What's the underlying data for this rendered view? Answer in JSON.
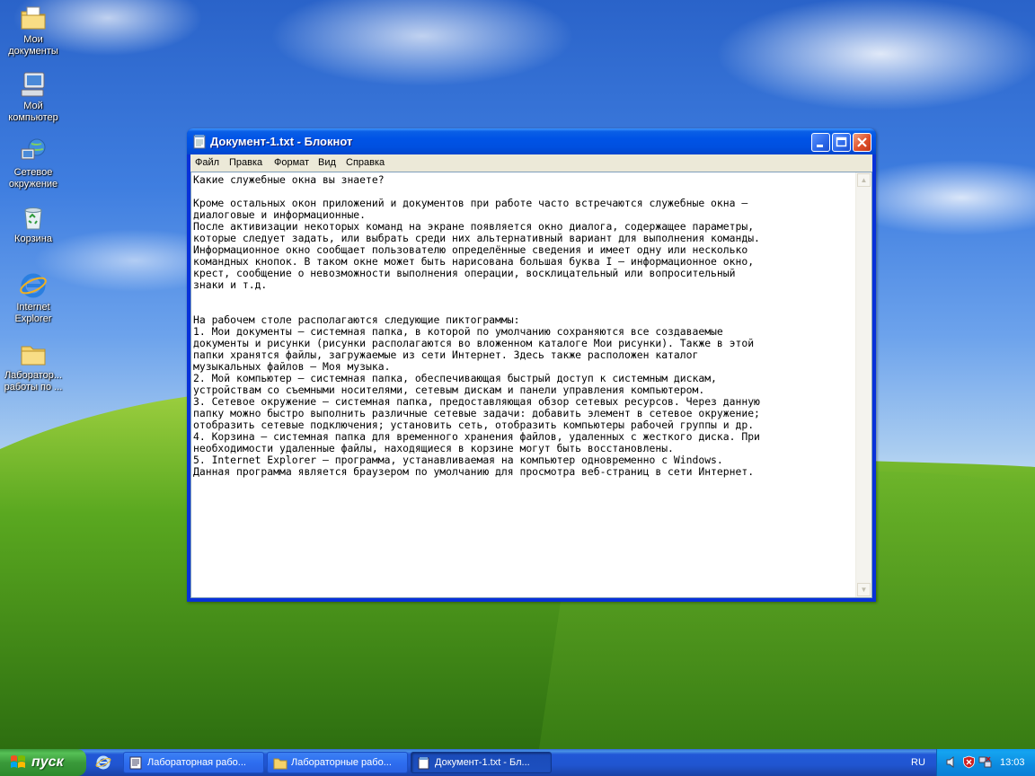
{
  "desktop": {
    "icons": [
      {
        "label": "Мои документы",
        "icon": "my-documents-icon"
      },
      {
        "label": "Мой компьютер",
        "icon": "my-computer-icon"
      },
      {
        "label": "Сетевое окружение",
        "icon": "network-icon"
      },
      {
        "label": "Корзина",
        "icon": "recycle-bin-icon"
      },
      {
        "label": "Internet Explorer",
        "icon": "internet-explorer-icon"
      },
      {
        "label": "Лаборатор... работы по ...",
        "icon": "folder-icon"
      }
    ]
  },
  "window": {
    "title": "Документ-1.txt - Блокнот",
    "menu": [
      "Файл",
      "Правка",
      "Формат",
      "Вид",
      "Справка"
    ],
    "text": "Какие служебные окна вы знаете?\n\nКроме остальных окон приложений и документов при работе часто встречаются служебные окна –\nдиалоговые и информационные.\nПосле активизации некоторых команд на экране появляется окно диалога, содержащее параметры,\nкоторые следует задать, или выбрать среди них альтернативный вариант для выполнения команды.\nИнформационное окно сообщает пользователю определённые сведения и имеет одну или несколько\nкомандных кнопок. В таком окне может быть нарисована большая буква I – информационное окно,\nкрест, сообщение о невозможности выполнения операции, восклицательный или вопросительный\nзнаки и т.д.\n\n\nНа рабочем столе располагаются следующие пиктограммы:\n1. Мои документы – системная папка, в которой по умолчанию сохраняются все создаваемые\nдокументы и рисунки (рисунки располагаются во вложенном каталоге Мои рисунки). Также в этой\nпапки хранятся файлы, загружаемые из сети Интернет. Здесь также расположен каталог\nмузыкальных файлов – Моя музыка.\n2. Мой компьютер – системная папка, обеспечивающая быстрый доступ к системным дискам,\nустройствам со съемными носителями, сетевым дискам и панели управления компьютером.\n3. Сетевое окружение – системная папка, предоставляющая обзор сетевых ресурсов. Через данную\nпапку можно быстро выполнить различные сетевые задачи: добавить элемент в сетевое окружение;\nотобразить сетевые подключения; установить сеть, отобразить компьютеры рабочей группы и др.\n4. Корзина – системная папка для временного хранения файлов, удаленных с жесткого диска. При\nнеобходимости удаленные файлы, находящиеся в корзине могут быть восстановлены.\n5. Internet Explorer – программа, устанавливаемая на компьютер одновременно с Windows.\nДанная программа является браузером по умолчанию для просмотра веб-страниц в сети Интернет."
  },
  "taskbar": {
    "start_label": "пуск",
    "tasks": [
      {
        "label": "Лабораторная рабо...",
        "icon": "word-document-icon",
        "active": false
      },
      {
        "label": "Лабораторные рабо...",
        "icon": "folder-icon",
        "active": false
      },
      {
        "label": "Документ-1.txt - Бл...",
        "icon": "notepad-icon",
        "active": true
      }
    ],
    "language": "RU",
    "clock": "13:03"
  }
}
